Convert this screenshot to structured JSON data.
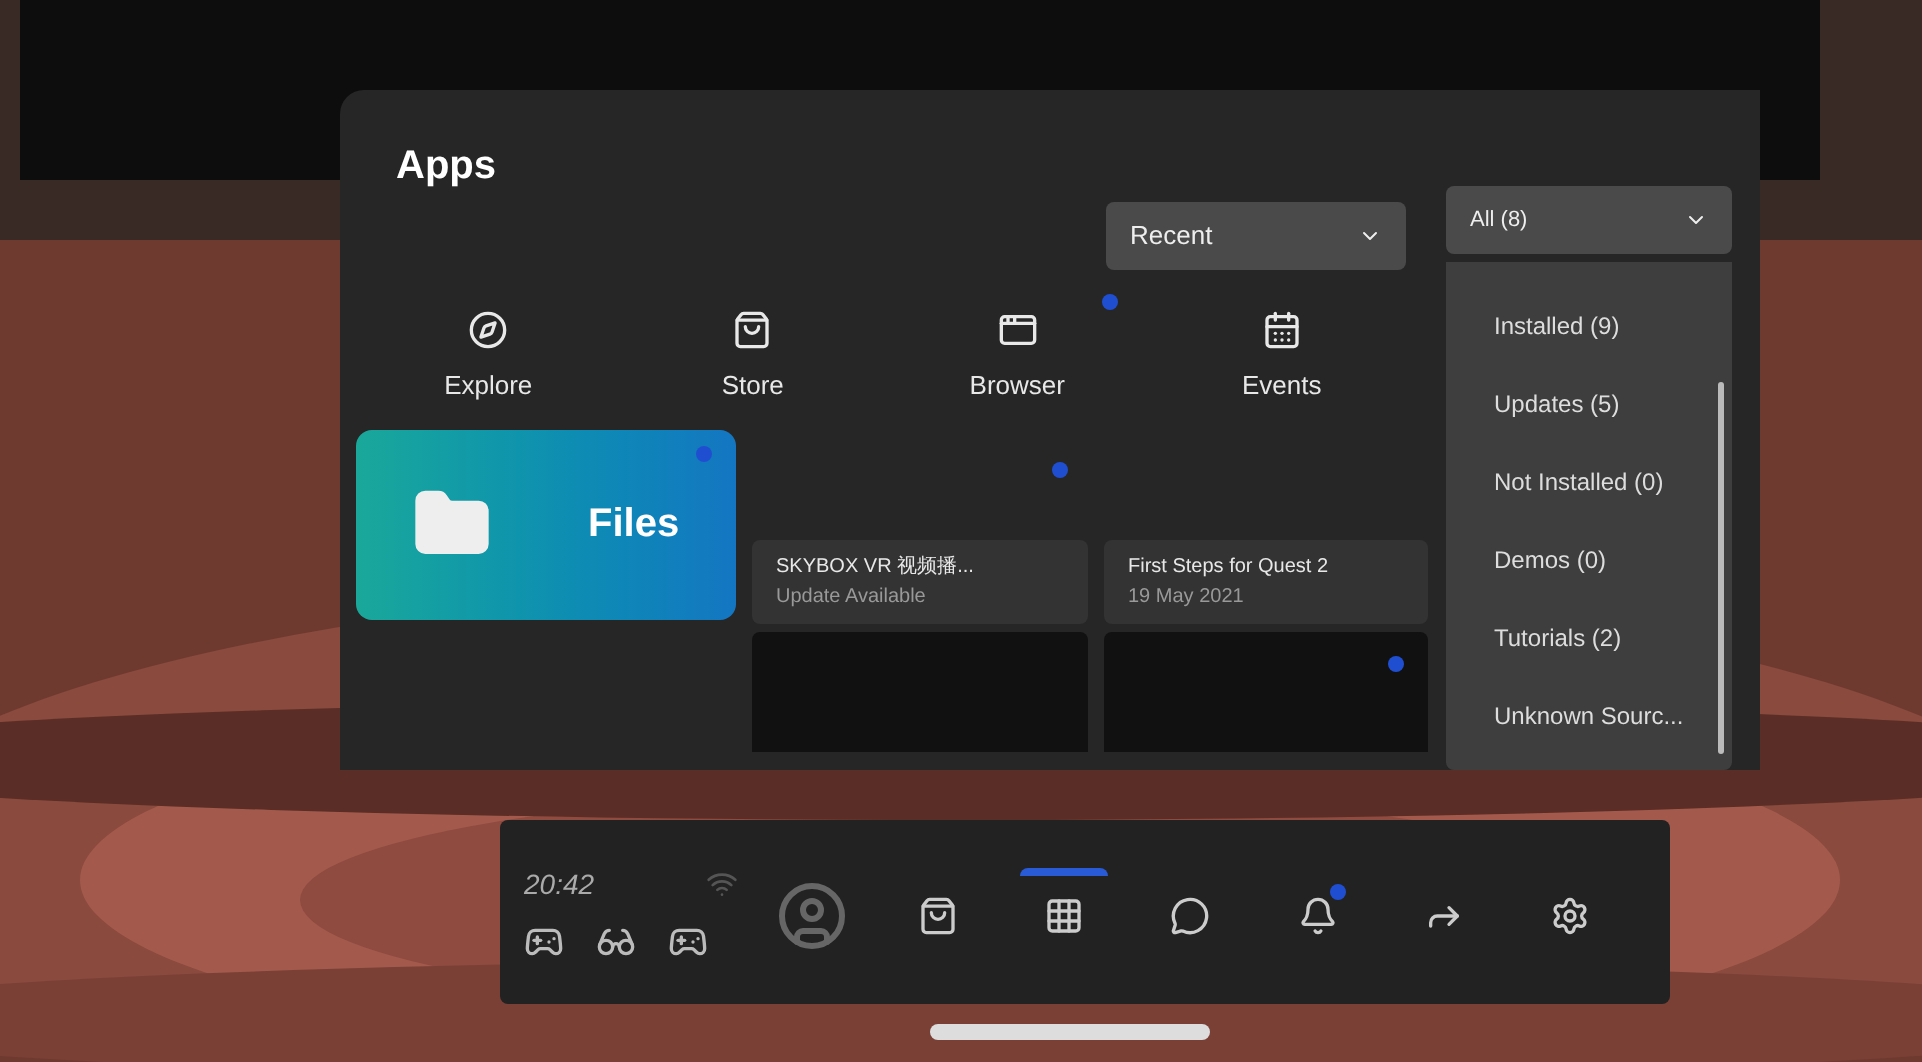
{
  "header": {
    "title": "Apps"
  },
  "sort_dropdown": {
    "value": "Recent"
  },
  "filter_dropdown": {
    "value": "All (8)",
    "expanded": true,
    "options": [
      {
        "label": "Installed (9)",
        "selected": false
      },
      {
        "label": "Updates (5)",
        "selected": false
      },
      {
        "label": "Not Installed (0)",
        "selected": false
      },
      {
        "label": "Demos (0)",
        "selected": false
      },
      {
        "label": "Tutorials (2)",
        "selected": false
      },
      {
        "label": "Unknown Sourc...",
        "selected": false
      }
    ]
  },
  "shortcuts": [
    {
      "label": "Explore",
      "kind": "explore",
      "badge": false
    },
    {
      "label": "Store",
      "kind": "store",
      "badge": false
    },
    {
      "label": "Browser",
      "kind": "browser",
      "badge": true
    },
    {
      "label": "Events",
      "kind": "events",
      "badge": false
    }
  ],
  "tiles": [
    {
      "kind": "featured",
      "title": "Files",
      "badge": true
    },
    {
      "kind": "app",
      "title": "SKYBOX VR 视频播...",
      "subtitle": "Update Available",
      "badge": true
    },
    {
      "kind": "app",
      "title": "First Steps for Quest 2",
      "subtitle": "19 May 2021",
      "badge": false
    },
    {
      "kind": "blank",
      "badge": false
    },
    {
      "kind": "blank",
      "badge": true
    }
  ],
  "taskbar": {
    "time": "20:42",
    "items": [
      {
        "kind": "profile",
        "selected": false,
        "badge": false
      },
      {
        "kind": "store",
        "selected": false,
        "badge": false
      },
      {
        "kind": "apps",
        "selected": true,
        "badge": false
      },
      {
        "kind": "messenger",
        "selected": false,
        "badge": false
      },
      {
        "kind": "notifications",
        "selected": false,
        "badge": true
      },
      {
        "kind": "share",
        "selected": false,
        "badge": false
      },
      {
        "kind": "settings",
        "selected": false,
        "badge": false
      }
    ]
  }
}
